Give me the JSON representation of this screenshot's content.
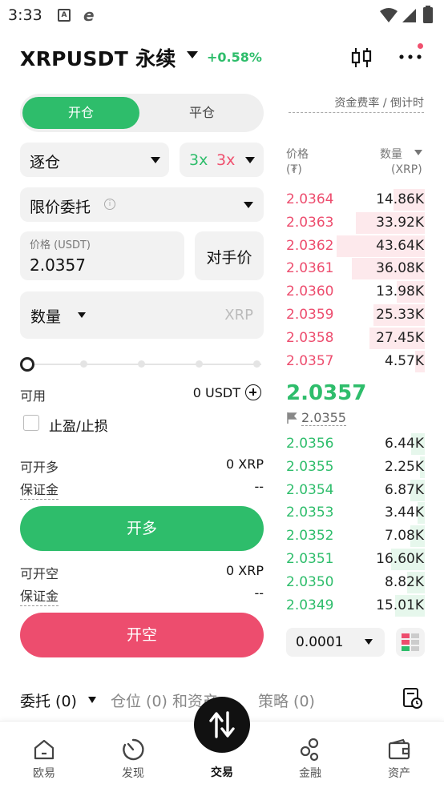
{
  "status_bar": {
    "time": "3:33",
    "icon1": "A",
    "icon2": "e"
  },
  "header": {
    "symbol": "XRPUSDT 永续",
    "change": "+0.58%"
  },
  "funding_label": "资金费率 / 倒计时",
  "trade_side": {
    "open": "开仓",
    "close": "平仓"
  },
  "margin_mode": "逐仓",
  "leverage": {
    "long": "3x",
    "short": "3x"
  },
  "order_type": "限价委托",
  "price_field": {
    "label": "价格 (USDT)",
    "value": "2.0357"
  },
  "counter_price_button": "对手价",
  "quantity_field": {
    "label": "数量",
    "unit": "XRP"
  },
  "slider_level": 0,
  "available": {
    "label": "可用",
    "value": "0 USDT"
  },
  "tp_sl_label": "止盈/止损",
  "long_section": {
    "max_label": "可开多",
    "max_value": "0 XRP",
    "margin_label": "保证金",
    "margin_value": "--",
    "button": "开多"
  },
  "short_section": {
    "max_label": "可开空",
    "max_value": "0 XRP",
    "margin_label": "保证金",
    "margin_value": "--",
    "button": "开空"
  },
  "orderbook": {
    "price_header": "价格",
    "price_unit": "(₮)",
    "qty_header": "数量",
    "qty_unit": "(XRP)",
    "asks": [
      {
        "price": "2.0364",
        "qty": "14.86K",
        "depth": 0.35
      },
      {
        "price": "2.0363",
        "qty": "33.92K",
        "depth": 0.78
      },
      {
        "price": "2.0362",
        "qty": "43.64K",
        "depth": 1.0
      },
      {
        "price": "2.0361",
        "qty": "36.08K",
        "depth": 0.83
      },
      {
        "price": "2.0360",
        "qty": "13.98K",
        "depth": 0.32
      },
      {
        "price": "2.0359",
        "qty": "25.33K",
        "depth": 0.58
      },
      {
        "price": "2.0358",
        "qty": "27.45K",
        "depth": 0.63
      },
      {
        "price": "2.0357",
        "qty": "4.57K",
        "depth": 0.11
      }
    ],
    "last_price": "2.0357",
    "mark_price": "2.0355",
    "bids": [
      {
        "price": "2.0356",
        "qty": "6.44K",
        "depth": 0.15
      },
      {
        "price": "2.0355",
        "qty": "2.25K",
        "depth": 0.05
      },
      {
        "price": "2.0354",
        "qty": "6.87K",
        "depth": 0.16
      },
      {
        "price": "2.0353",
        "qty": "3.44K",
        "depth": 0.08
      },
      {
        "price": "2.0352",
        "qty": "7.08K",
        "depth": 0.16
      },
      {
        "price": "2.0351",
        "qty": "16.60K",
        "depth": 0.38
      },
      {
        "price": "2.0350",
        "qty": "8.82K",
        "depth": 0.2
      },
      {
        "price": "2.0349",
        "qty": "15.01K",
        "depth": 0.34
      }
    ],
    "precision": "0.0001"
  },
  "order_tabs": {
    "orders": "委托 (0)",
    "positions": "仓位 (0) 和资产",
    "strategy": "策略 (0)"
  },
  "nav": [
    {
      "label": "欧易",
      "icon": "home-icon"
    },
    {
      "label": "发现",
      "icon": "discover-icon"
    },
    {
      "label": "交易",
      "icon": "trade-icon"
    },
    {
      "label": "金融",
      "icon": "finance-icon"
    },
    {
      "label": "资产",
      "icon": "wallet-icon"
    }
  ],
  "colors": {
    "green": "#2ebd6b",
    "red": "#ed4d6e"
  }
}
